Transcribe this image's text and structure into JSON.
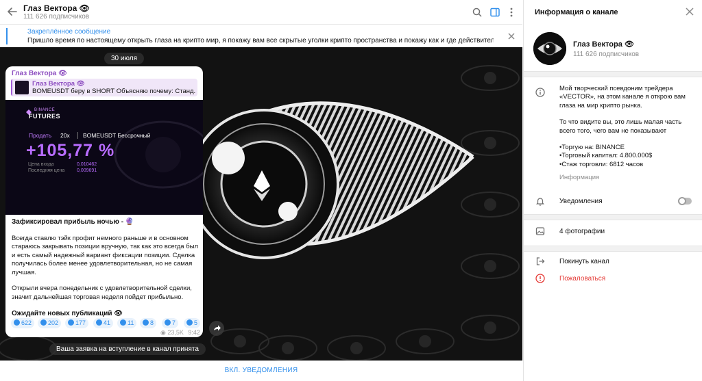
{
  "header": {
    "title": "Глаз Вектора 👁",
    "subtitle": "111 626 подписчиков"
  },
  "pinned": {
    "title": "Закреплённое сообщение",
    "text": "Пришло время по настоящему открыть глаза на крипто мир, я покажу вам все скрытые уголки крипто пространства и покажу как и где действительно мо..."
  },
  "chat": {
    "date": "30 июля",
    "notice": "Ваша заявка на вступление в канал принята",
    "bottom_button": "ВКЛ. УВЕДОМЛЕНИЯ"
  },
  "message": {
    "author": "Глаз Вектора 👁",
    "reply_author": "Глаз Вектора 👁",
    "reply_text": "BOMEUSDT беру в SHORT  Объясняю почему: Станд...",
    "card": {
      "brand_top": "BINANCE",
      "brand_bottom": "FUTURES",
      "side": "Продать",
      "leverage": "20x",
      "pair": "BOMEUSDT Бессрочный",
      "roi": "+105,77 %",
      "entry_label": "Цена входа",
      "entry_value": "0,010462",
      "last_label": "Последняя цена",
      "last_value": "0,009691"
    },
    "headline": "Зафиксировал прибыль ночью - 🔮",
    "paragraphs": [
      "Всегда ставлю тэйк профит немного раньше и в основном стараюсь закрывать позиции вручную, так как это всегда был и есть самый надежный вариант фиксации позиции. Сделка получилась более менее удовлетворительная, но не самая лучшая.",
      "Открыли вчера понедельник с удовлетворительной сделки, значит дальнейшая торговая неделя пойдет прибыльно."
    ],
    "callout": "Ожидайте новых публикаций 👁",
    "reactions": [
      {
        "icon": "heart-icon",
        "count": "622"
      },
      {
        "icon": "thumbs-down-icon",
        "count": "202"
      },
      {
        "icon": "thumbs-up-icon",
        "count": "177"
      },
      {
        "icon": "emoji-icon",
        "count": "41"
      },
      {
        "icon": "emoji-icon",
        "count": "11"
      },
      {
        "icon": "emoji-icon",
        "count": "8"
      },
      {
        "icon": "emoji-icon",
        "count": "7"
      },
      {
        "icon": "emoji-icon",
        "count": "5"
      }
    ],
    "views": "23,5K",
    "time": "9:42"
  },
  "info": {
    "header": "Информация о канале",
    "name": "Глаз Вектора 👁",
    "subscribers": "111 626 подписчиков",
    "description_lines": [
      "Мой творческий псевдоним трейдера",
      "«VECTOR», на этом канале я открою вам",
      "глаза на мир крипто рынка."
    ],
    "description_lines2": [
      "То что видите вы, это лишь малая часть",
      "всего того, чего вам не показывают"
    ],
    "description_lines3": [
      "•Торгую на: BINANCE",
      "•Торговый капитал: 4.800.000$",
      "•Стаж торговли: 6812 часов"
    ],
    "description_label": "Информация",
    "notifications": "Уведомления",
    "notifications_on": false,
    "photos": "4 фотографии",
    "leave": "Покинуть канал",
    "report": "Пожаловаться"
  },
  "colors": {
    "accent": "#3390ec",
    "author_purple": "#8e4fc1",
    "danger": "#e53935",
    "roi_purple": "#b86cff"
  }
}
